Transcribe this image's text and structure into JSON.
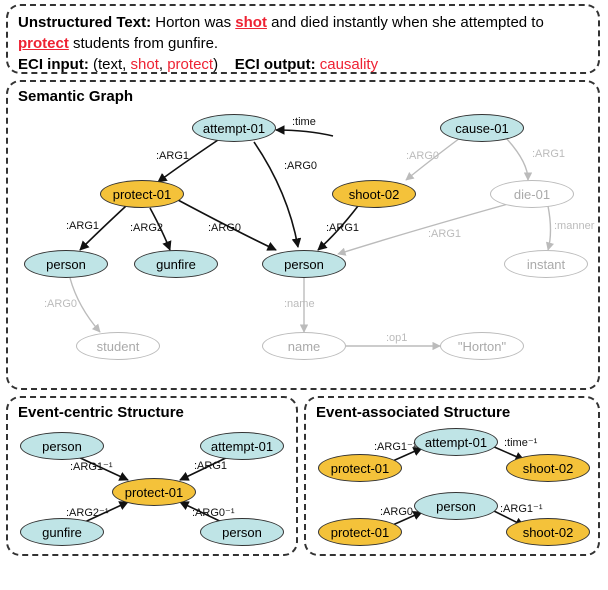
{
  "input": {
    "label_text": "Unstructured Text:",
    "sentence_pre": "Horton was ",
    "word_shot": "shot",
    "sentence_mid": " and died instantly when she attempted to ",
    "word_protect": "protect",
    "sentence_post": " students from gunfire.",
    "eci_input_label": "ECI input:",
    "eci_input_value": "(text, shot, protect)",
    "eci_output_label": "ECI output:",
    "eci_output_value": "causality"
  },
  "panels": {
    "graph": "Semantic Graph",
    "ecs": "Event-centric Structure",
    "eas": "Event-associated Structure"
  },
  "graph_nodes": {
    "attempt": "attempt-01",
    "cause": "cause-01",
    "protect": "protect-01",
    "shoot": "shoot-02",
    "die": "die-01",
    "person1": "person",
    "gunfire": "gunfire",
    "person2": "person",
    "instant": "instant",
    "student": "student",
    "name": "name",
    "horton": "\"Horton\""
  },
  "graph_edges": {
    "at_pr_arg1": ":ARG1",
    "at_sh_time": ":time",
    "at_p2_arg0": ":ARG0",
    "ca_sh_arg0": ":ARG0",
    "ca_di_arg1": ":ARG1",
    "pr_p1_arg1": ":ARG1",
    "pr_gf_arg2": ":ARG2",
    "pr_p2_arg0": ":ARG0",
    "sh_p2_arg1": ":ARG1",
    "di_in_manner": ":manner",
    "di_p2_arg1": ":ARG1",
    "p1_st_arg0": ":ARG0",
    "p2_nm_name": ":name",
    "nm_ho_op1": ":op1"
  },
  "ecs": {
    "person1": "person",
    "attempt": "attempt-01",
    "protect": "protect-01",
    "gunfire": "gunfire",
    "person2": "person",
    "e_p1_pr": ":ARG1⁻¹",
    "e_at_pr": ":ARG1",
    "e_gf_pr": ":ARG2⁻¹",
    "e_p2_pr": ":ARG0⁻¹"
  },
  "eas": {
    "attempt": "attempt-01",
    "protect1": "protect-01",
    "shoot1": "shoot-02",
    "person": "person",
    "protect2": "protect-01",
    "shoot2": "shoot-02",
    "e_pr_at": ":ARG1⁻¹",
    "e_at_sh": ":time⁻¹",
    "e_pr_p": ":ARG0",
    "e_p_sh": ":ARG1⁻¹"
  },
  "caption": ""
}
